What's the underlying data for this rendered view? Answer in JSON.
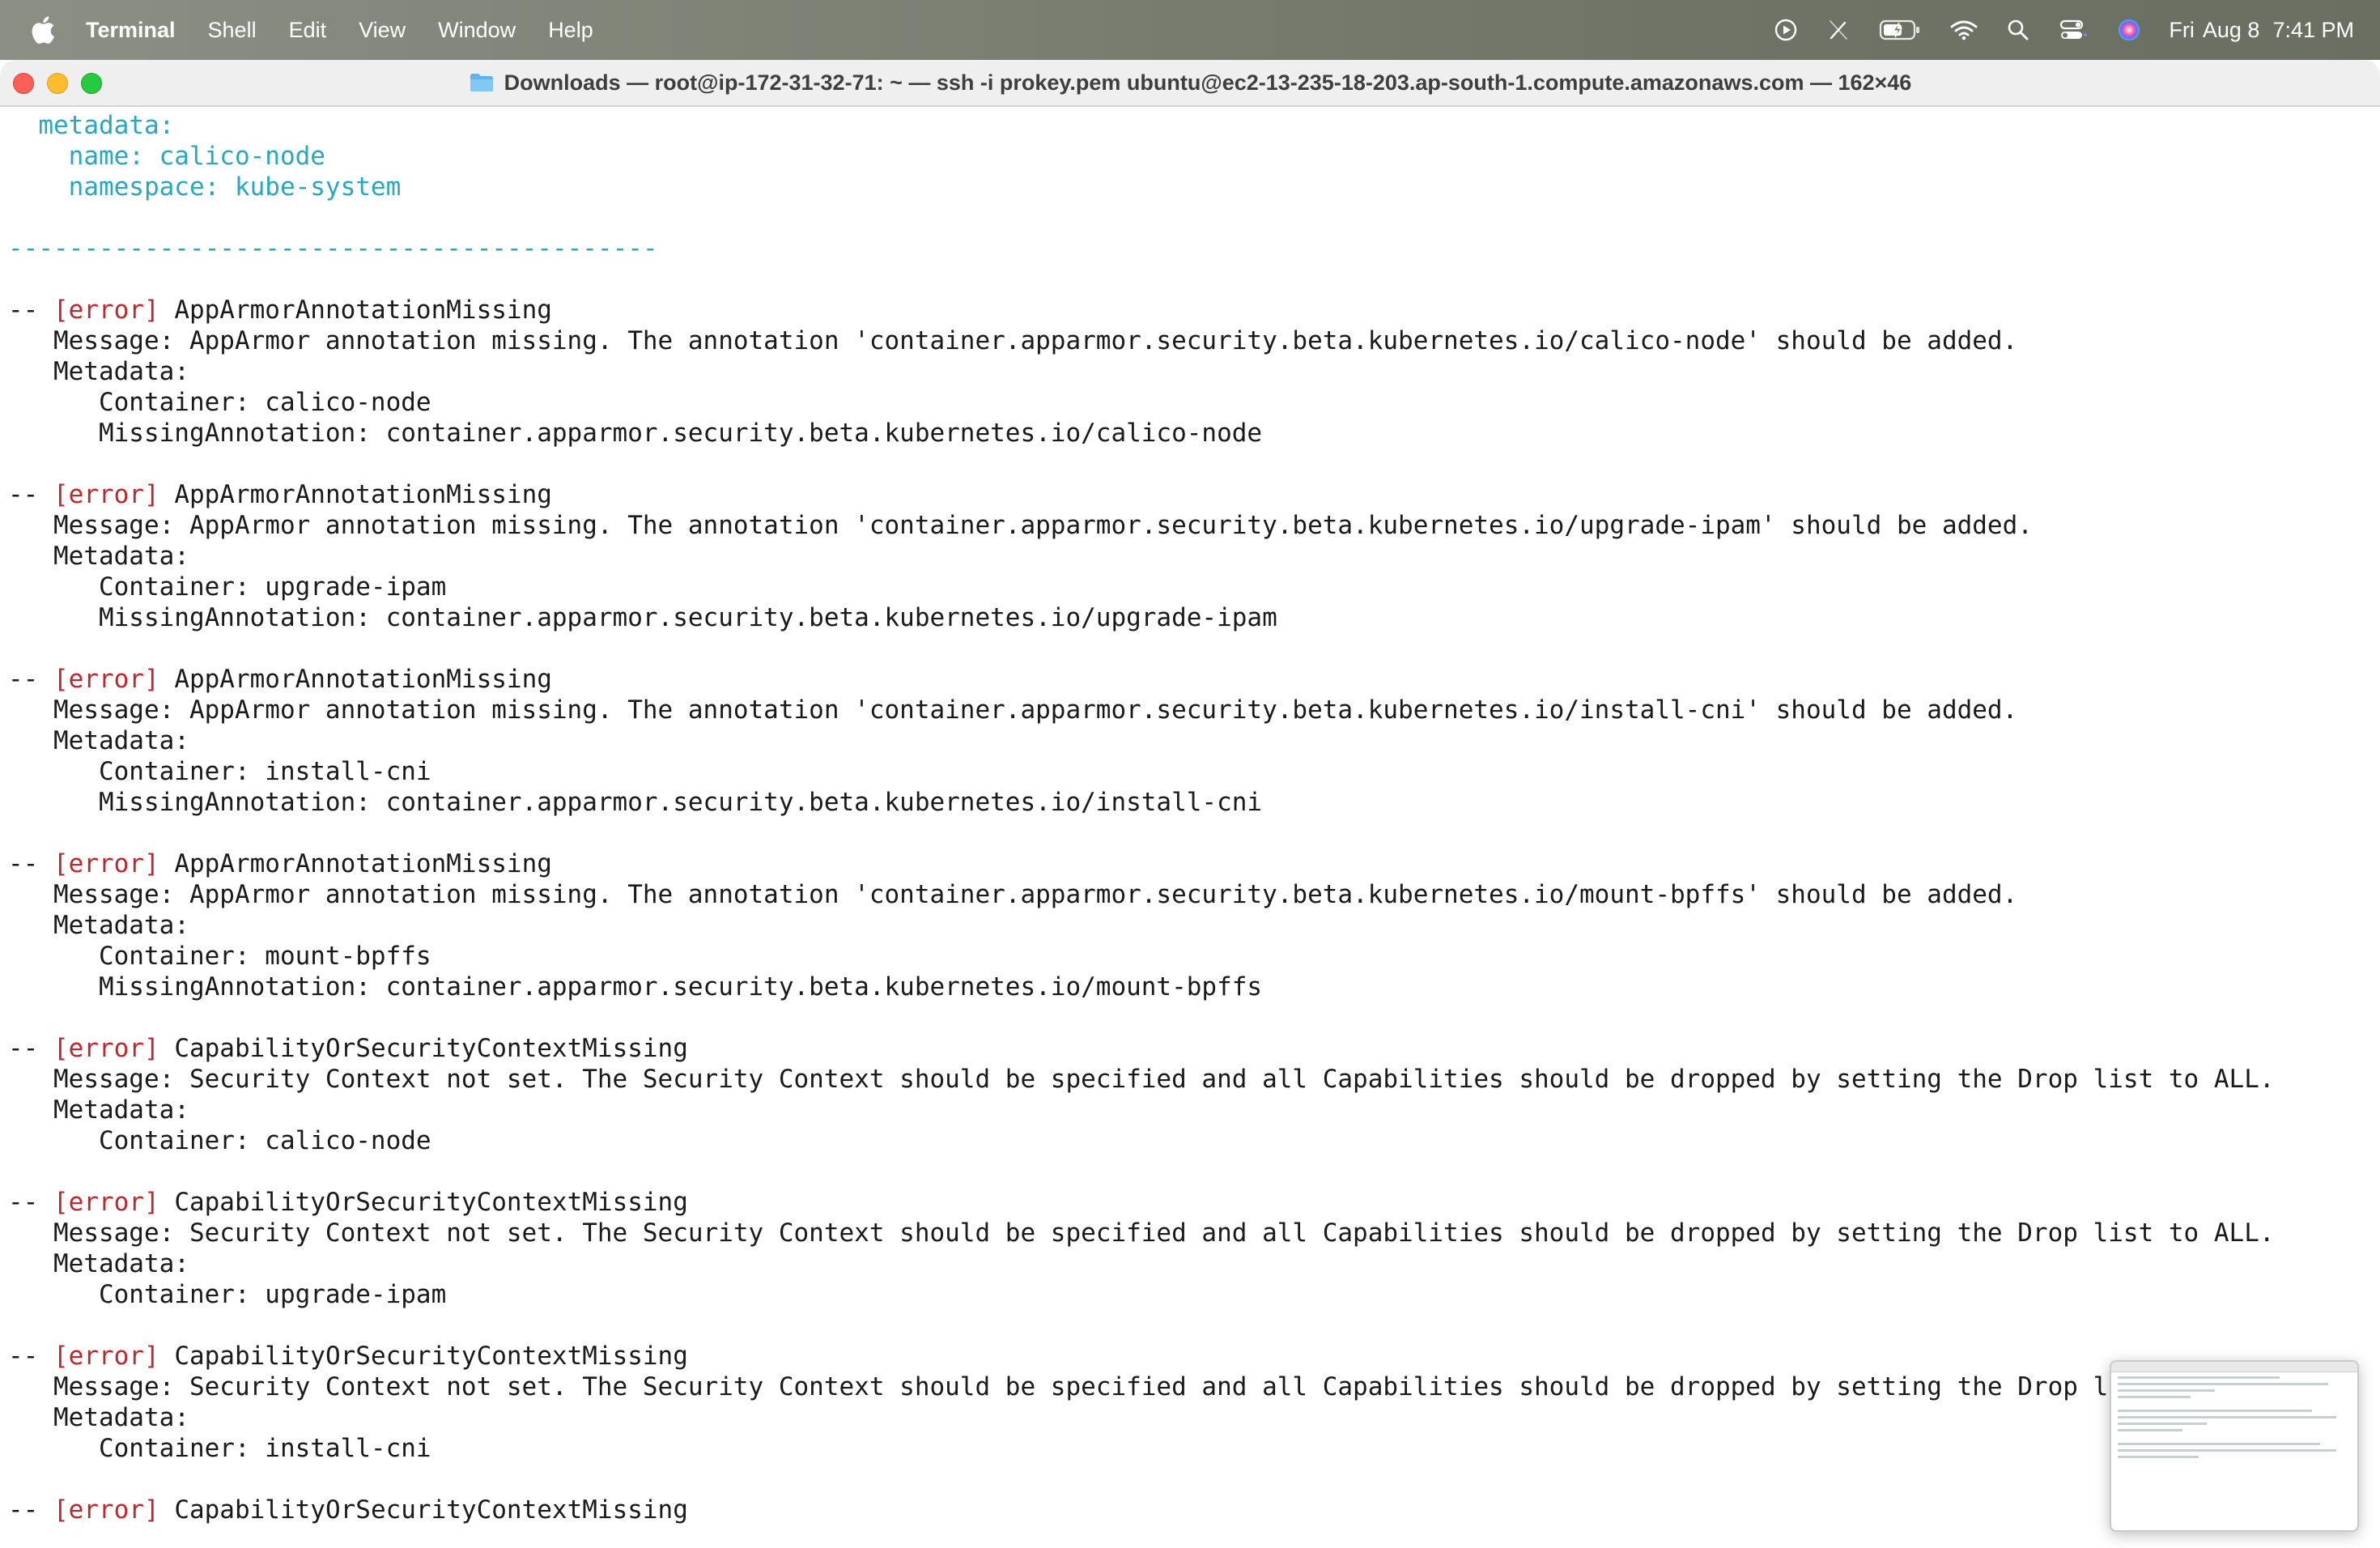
{
  "menubar": {
    "app_name": "Terminal",
    "items": [
      "Shell",
      "Edit",
      "View",
      "Window",
      "Help"
    ],
    "clock": {
      "day": "Fri",
      "date": "Aug 8",
      "time": "7:41 PM"
    }
  },
  "window": {
    "title": "Downloads — root@ip-172-31-32-71: ~ — ssh -i prokey.pem ubuntu@ec2-13-235-18-203.ap-south-1.compute.amazonaws.com — 162×46"
  },
  "terminal": {
    "lines": [
      [
        {
          "t": "  metadata:",
          "c": "cyan"
        }
      ],
      [
        {
          "t": "    name: calico-node",
          "c": "cyan"
        }
      ],
      [
        {
          "t": "    namespace: kube-system",
          "c": "cyan"
        }
      ],
      [
        {
          "t": ""
        }
      ],
      [
        {
          "t": "-------------------------------------------",
          "c": "cyan"
        }
      ],
      [
        {
          "t": ""
        }
      ],
      [
        {
          "t": "-- "
        },
        {
          "t": "[error]",
          "c": "red"
        },
        {
          "t": " AppArmorAnnotationMissing"
        }
      ],
      [
        {
          "t": "   Message: AppArmor annotation missing. The annotation 'container.apparmor.security.beta.kubernetes.io/calico-node' should be added."
        }
      ],
      [
        {
          "t": "   Metadata:"
        }
      ],
      [
        {
          "t": "      Container: calico-node"
        }
      ],
      [
        {
          "t": "      MissingAnnotation: container.apparmor.security.beta.kubernetes.io/calico-node"
        }
      ],
      [
        {
          "t": ""
        }
      ],
      [
        {
          "t": "-- "
        },
        {
          "t": "[error]",
          "c": "red"
        },
        {
          "t": " AppArmorAnnotationMissing"
        }
      ],
      [
        {
          "t": "   Message: AppArmor annotation missing. The annotation 'container.apparmor.security.beta.kubernetes.io/upgrade-ipam' should be added."
        }
      ],
      [
        {
          "t": "   Metadata:"
        }
      ],
      [
        {
          "t": "      Container: upgrade-ipam"
        }
      ],
      [
        {
          "t": "      MissingAnnotation: container.apparmor.security.beta.kubernetes.io/upgrade-ipam"
        }
      ],
      [
        {
          "t": ""
        }
      ],
      [
        {
          "t": "-- "
        },
        {
          "t": "[error]",
          "c": "red"
        },
        {
          "t": " AppArmorAnnotationMissing"
        }
      ],
      [
        {
          "t": "   Message: AppArmor annotation missing. The annotation 'container.apparmor.security.beta.kubernetes.io/install-cni' should be added."
        }
      ],
      [
        {
          "t": "   Metadata:"
        }
      ],
      [
        {
          "t": "      Container: install-cni"
        }
      ],
      [
        {
          "t": "      MissingAnnotation: container.apparmor.security.beta.kubernetes.io/install-cni"
        }
      ],
      [
        {
          "t": ""
        }
      ],
      [
        {
          "t": "-- "
        },
        {
          "t": "[error]",
          "c": "red"
        },
        {
          "t": " AppArmorAnnotationMissing"
        }
      ],
      [
        {
          "t": "   Message: AppArmor annotation missing. The annotation 'container.apparmor.security.beta.kubernetes.io/mount-bpffs' should be added."
        }
      ],
      [
        {
          "t": "   Metadata:"
        }
      ],
      [
        {
          "t": "      Container: mount-bpffs"
        }
      ],
      [
        {
          "t": "      MissingAnnotation: container.apparmor.security.beta.kubernetes.io/mount-bpffs"
        }
      ],
      [
        {
          "t": ""
        }
      ],
      [
        {
          "t": "-- "
        },
        {
          "t": "[error]",
          "c": "red"
        },
        {
          "t": " CapabilityOrSecurityContextMissing"
        }
      ],
      [
        {
          "t": "   Message: Security Context not set. The Security Context should be specified and all Capabilities should be dropped by setting the Drop list to ALL."
        }
      ],
      [
        {
          "t": "   Metadata:"
        }
      ],
      [
        {
          "t": "      Container: calico-node"
        }
      ],
      [
        {
          "t": ""
        }
      ],
      [
        {
          "t": "-- "
        },
        {
          "t": "[error]",
          "c": "red"
        },
        {
          "t": " CapabilityOrSecurityContextMissing"
        }
      ],
      [
        {
          "t": "   Message: Security Context not set. The Security Context should be specified and all Capabilities should be dropped by setting the Drop list to ALL."
        }
      ],
      [
        {
          "t": "   Metadata:"
        }
      ],
      [
        {
          "t": "      Container: upgrade-ipam"
        }
      ],
      [
        {
          "t": ""
        }
      ],
      [
        {
          "t": "-- "
        },
        {
          "t": "[error]",
          "c": "red"
        },
        {
          "t": " CapabilityOrSecurityContextMissing"
        }
      ],
      [
        {
          "t": "   Message: Security Context not set. The Security Context should be specified and all Capabilities should be dropped by setting the Drop list t"
        }
      ],
      [
        {
          "t": "   Metadata:"
        }
      ],
      [
        {
          "t": "      Container: install-cni"
        }
      ],
      [
        {
          "t": ""
        }
      ],
      [
        {
          "t": "-- "
        },
        {
          "t": "[error]",
          "c": "red"
        },
        {
          "t": " CapabilityOrSecurityContextMissing"
        }
      ]
    ]
  },
  "colors": {
    "cyan": "#2aa6bf",
    "error_red": "#c0262b",
    "text": "#1a1a1a"
  },
  "icons": {
    "menubar": [
      "apple-icon",
      "screen-record-icon",
      "pen-slash-icon",
      "battery-charging-icon",
      "wifi-icon",
      "search-icon",
      "control-center-icon",
      "siri-icon"
    ],
    "titlebar": [
      "folder-icon"
    ]
  }
}
